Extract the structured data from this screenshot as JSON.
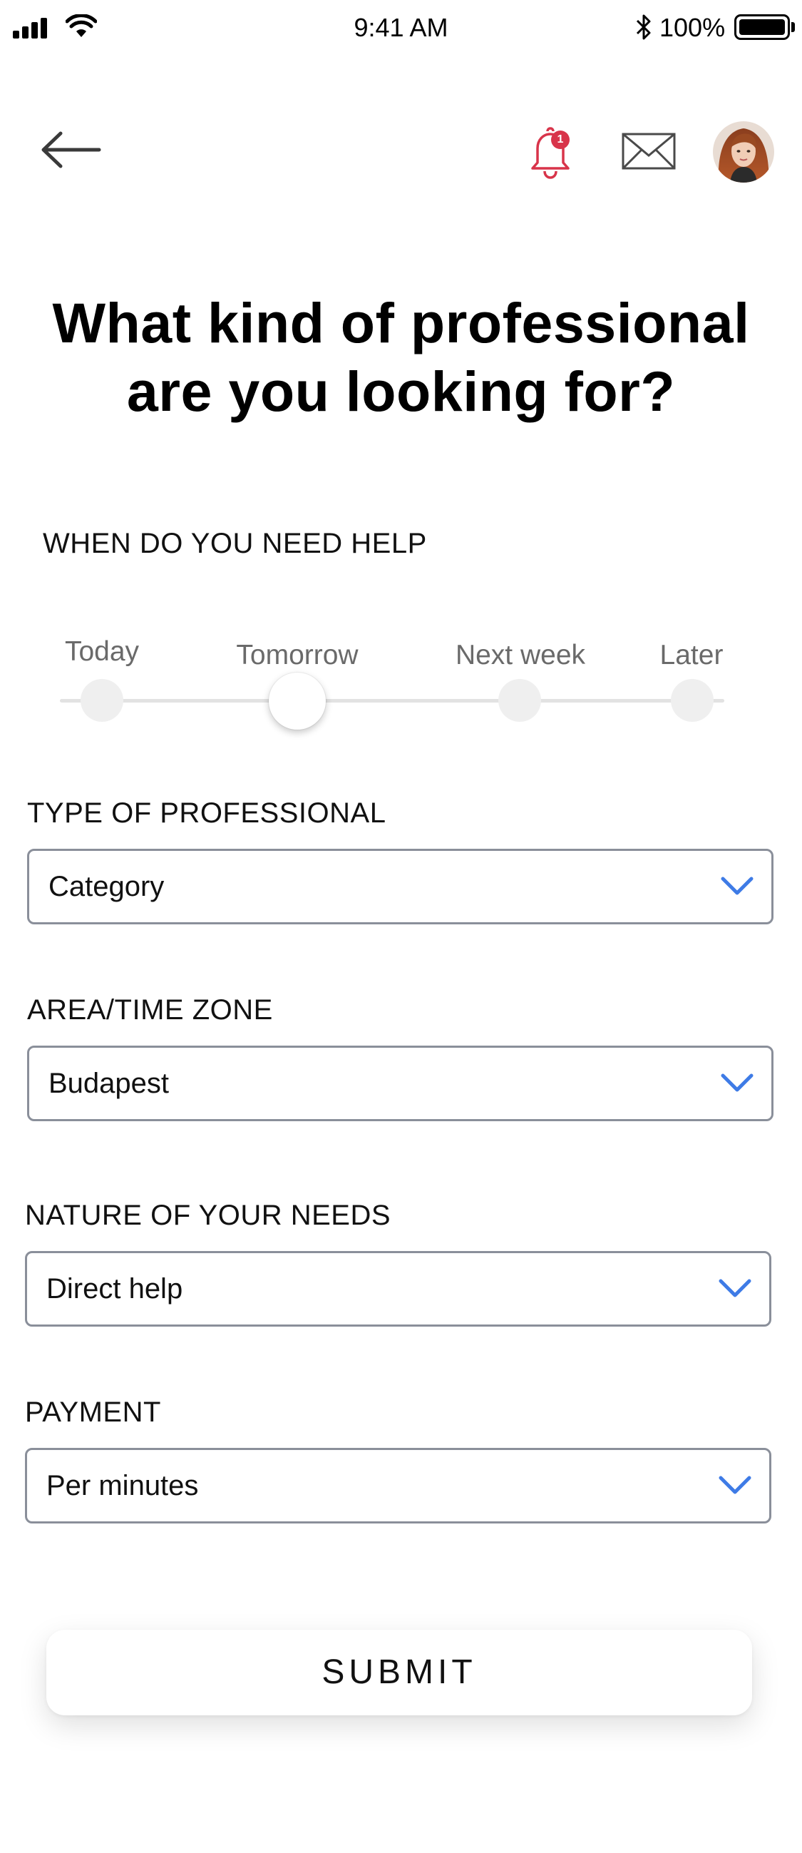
{
  "status_bar": {
    "time": "9:41 AM",
    "battery": "100%"
  },
  "header": {
    "back_icon": "arrow-left-icon",
    "notification_icon": "bell-icon",
    "notification_count": "1",
    "mail_icon": "envelope-icon",
    "avatar_icon": "user-avatar",
    "accent_color": "#d8344a"
  },
  "page_title": "What kind of professional are you looking for?",
  "when": {
    "label": "WHEN DO YOU NEED HELP",
    "options": [
      "Today",
      "Tomorrow",
      "Next week",
      "Later"
    ],
    "selected": "Tomorrow"
  },
  "type": {
    "label": "TYPE OF PROFESSIONAL",
    "value": "Category"
  },
  "area": {
    "label": "AREA/TIME ZONE",
    "value": "Budapest"
  },
  "nature": {
    "label": "NATURE OF YOUR NEEDS",
    "value": "Direct help"
  },
  "payment": {
    "label": "PAYMENT",
    "value": "Per minutes"
  },
  "submit_label": "SUBMIT",
  "colors": {
    "chevron": "#3e7be6",
    "field_border": "#8a8f9a"
  }
}
